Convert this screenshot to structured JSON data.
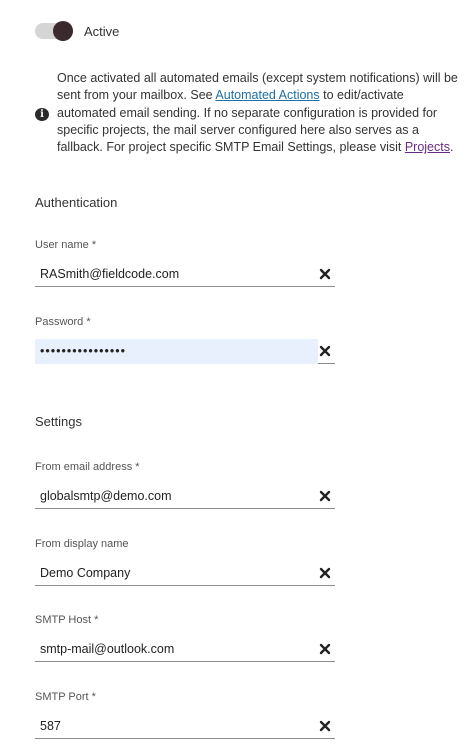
{
  "toggle": {
    "label": "Active",
    "state": "on"
  },
  "info": {
    "text_before_link1": "Once activated all automated emails (except system notifications) will be sent from your mailbox. See ",
    "link1": "Automated Actions",
    "text_between_links": " to edit/activate automated email sending. If no separate configuration is provided for specific projects, the mail server configured here also serves as a fallback. For project specific SMTP Email Settings, please visit ",
    "link2": "Projects",
    "text_after_link2": ".",
    "icon": "info-icon"
  },
  "authentication": {
    "title": "Authentication",
    "username": {
      "label": "User name *",
      "value": "RASmith@fieldcode.com"
    },
    "password": {
      "label": "Password *",
      "value": "••••••••••••••••"
    }
  },
  "settings": {
    "title": "Settings",
    "from_email": {
      "label": "From email address *",
      "value": "globalsmtp@demo.com"
    },
    "display_name": {
      "label": "From display name",
      "value": "Demo Company"
    },
    "smtp_host": {
      "label": "SMTP Host *",
      "value": "smtp-mail@outlook.com"
    },
    "smtp_port": {
      "label": "SMTP Port *",
      "value": "587"
    }
  },
  "colors": {
    "toggle_thumb": "#3a2a2d",
    "link": "#1d6fa5",
    "visited_link": "#6a2b86",
    "autofill_bg": "#e8f0fe"
  }
}
